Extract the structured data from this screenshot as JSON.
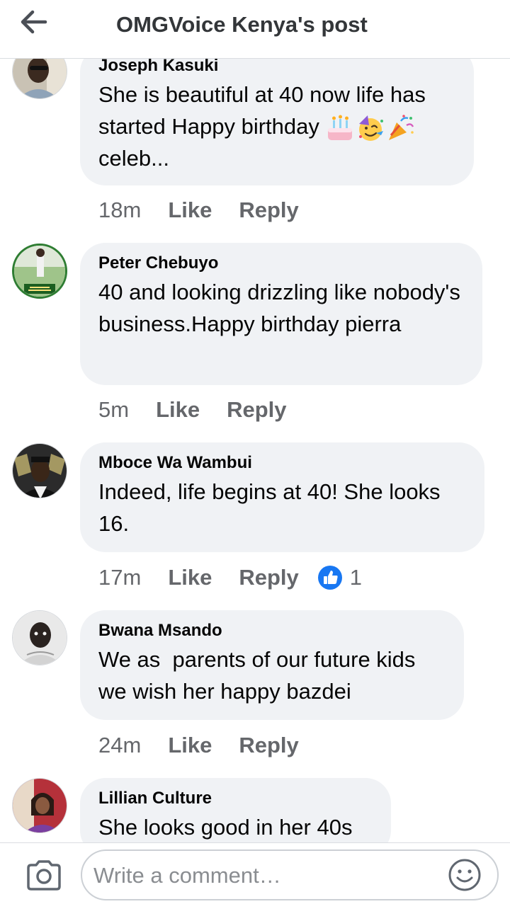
{
  "header": {
    "title": "OMGVoice Kenya's post",
    "back_icon": "arrow-left-icon"
  },
  "comments": [
    {
      "author": "Joseph Kasuki",
      "text_line": "She is beautiful at 40 now life has started Happy birthday",
      "text_tail": "celeb...",
      "emojis": [
        "birthday-cake-icon",
        "partying-face-icon",
        "party-popper-icon"
      ],
      "time": "18m",
      "like_label": "Like",
      "reply_label": "Reply"
    },
    {
      "author": "Peter Chebuyo",
      "text": "40 and looking drizzling like nobody's business.Happy birthday pierra",
      "time": "5m",
      "like_label": "Like",
      "reply_label": "Reply"
    },
    {
      "author": "Mboce Wa Wambui",
      "text": "Indeed, life begins at 40! She looks 16.",
      "time": "17m",
      "like_label": "Like",
      "reply_label": "Reply",
      "reaction_icon": "thumbs-up-icon",
      "reaction_count": "1"
    },
    {
      "author": "Bwana Msando",
      "text": "We as  parents of our future kids we wish her happy bazdei",
      "time": "24m",
      "like_label": "Like",
      "reply_label": "Reply"
    },
    {
      "author": "Lillian Culture",
      "text": "She looks good in her 40s"
    }
  ],
  "composer": {
    "placeholder": "Write a comment…",
    "camera_icon": "camera-icon",
    "emoji_icon": "smiley-face-icon"
  },
  "colors": {
    "bubble": "#f0f2f5",
    "secondary_text": "#65676b",
    "like_blue": "#1877f2"
  }
}
